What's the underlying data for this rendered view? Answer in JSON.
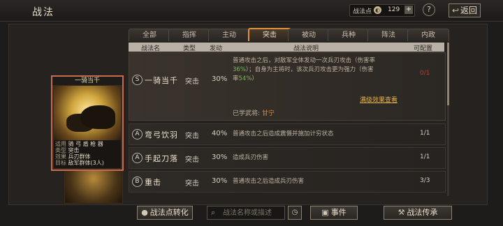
{
  "header": {
    "title": "战法",
    "points_label": "战法点",
    "points_value": "129",
    "plus_label": "+",
    "help_label": "?",
    "back_label": "返回"
  },
  "tabs": [
    {
      "label": "全部"
    },
    {
      "label": "指挥"
    },
    {
      "label": "主动"
    },
    {
      "label": "突击",
      "active": true
    },
    {
      "label": "被动"
    },
    {
      "label": "兵种"
    },
    {
      "label": "阵法"
    },
    {
      "label": "内政"
    }
  ],
  "table_headers": {
    "name": "战法名",
    "type": "类型",
    "rate": "发动",
    "desc": "战法说明",
    "config": "可配置"
  },
  "card": {
    "name": "一骑当千",
    "rows": [
      {
        "k": "适用",
        "v": "骑 弓 盾 枪 器"
      },
      {
        "k": "类型",
        "v": "突击"
      },
      {
        "k": "效果",
        "v": "兵刃群体"
      },
      {
        "k": "目标",
        "v": "敌军群体(3人)"
      }
    ]
  },
  "rows": [
    {
      "grade": "S",
      "name": "一骑当千",
      "type": "突击",
      "rate": "30%",
      "desc_lines": [
        "普通攻击之后，对敌军全体发动一次兵刃攻击（伤害率",
        "36%）；自身为主将时，该次兵刃攻击更为强力（伤害",
        "率54%）"
      ],
      "desc_green": [
        "36%",
        "54%"
      ],
      "count": "0/1",
      "more": "满级效果查看",
      "learned_label": "已学武将:",
      "learned_general": "甘宁"
    },
    {
      "grade": "A",
      "name": "弯弓饮羽",
      "type": "突击",
      "rate": "40%",
      "desc": "普通攻击之后造成震慑并施加计穷状态",
      "count": "1/1"
    },
    {
      "grade": "A",
      "name": "手起刀落",
      "type": "突击",
      "rate": "30%",
      "desc": "造成兵刃伤害",
      "count": "1/1"
    },
    {
      "grade": "B",
      "name": "重击",
      "type": "突击",
      "rate": "30%",
      "desc": "普通攻击之后造成兵刃伤害",
      "count": "3/3"
    }
  ],
  "bottom": {
    "convert_label": "战法点转化",
    "search_placeholder": "战法名称或描述",
    "event_label": "事件",
    "inherit_label": "战法传承"
  }
}
